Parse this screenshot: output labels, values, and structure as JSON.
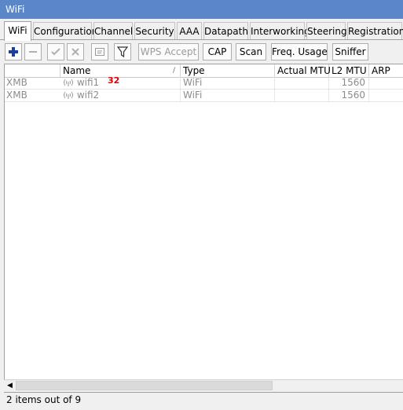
{
  "window": {
    "title": "WiFi"
  },
  "tabs": [
    {
      "label": "WiFi",
      "active": true
    },
    {
      "label": "Configuration"
    },
    {
      "label": "Channel"
    },
    {
      "label": "Security"
    },
    {
      "label": "AAA"
    },
    {
      "label": "Datapath"
    },
    {
      "label": "Interworking"
    },
    {
      "label": "Steering"
    },
    {
      "label": "Registration"
    }
  ],
  "toolbar": {
    "add_icon": "plus-icon",
    "remove_icon": "minus-icon",
    "enable_icon": "check-icon",
    "disable_icon": "x-icon",
    "comment_icon": "comment-icon",
    "filter_icon": "filter-icon",
    "wps_accept": "WPS Accept",
    "cap": "CAP",
    "scan": "Scan",
    "freq_usage": "Freq. Usage",
    "sniffer": "Sniffer"
  },
  "table": {
    "columns": [
      "Name",
      "Type",
      "Actual MTU",
      "L2 MTU",
      "ARP"
    ],
    "rows": [
      {
        "flag": "XMB",
        "name": "wifi1",
        "type": "WiFi",
        "actual_mtu": "",
        "l2_mtu": "1560",
        "arp": ""
      },
      {
        "flag": "XMB",
        "name": "wifi2",
        "type": "WiFi",
        "actual_mtu": "",
        "l2_mtu": "1560",
        "arp": ""
      }
    ]
  },
  "annotation": "32",
  "status": "2 items out of 9",
  "colors": {
    "titlebar": "#5b87c8",
    "add_icon": "#1f3f9a",
    "annotation": "#e00000",
    "disabled_row_text": "#8c8c8c"
  }
}
